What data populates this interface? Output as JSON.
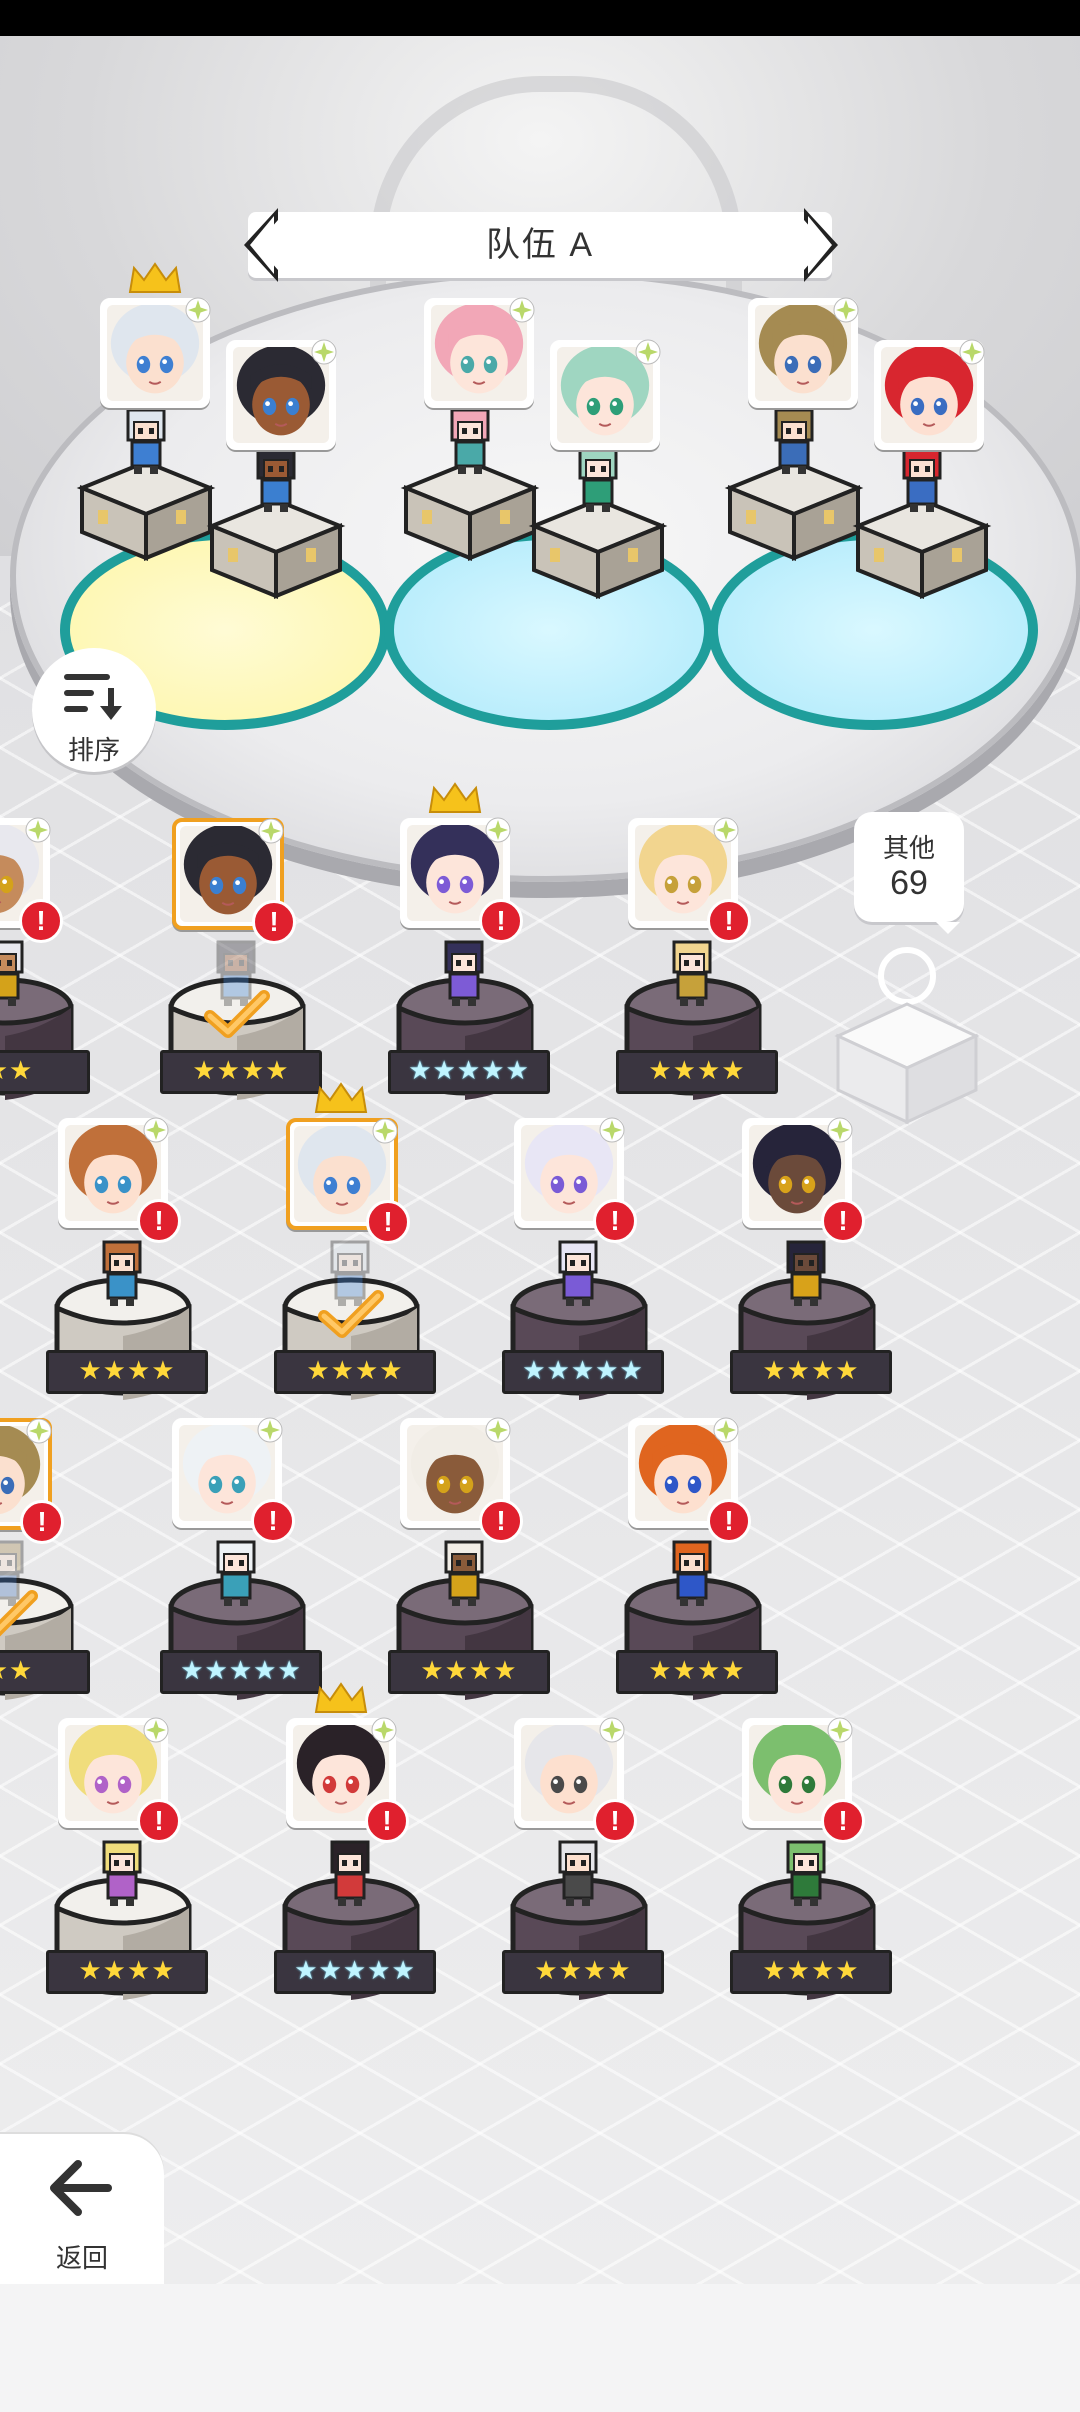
{
  "header": {
    "team_title": "队伍 A"
  },
  "sort": {
    "label": "排序"
  },
  "other": {
    "label": "其他",
    "count": "69"
  },
  "nav": {
    "back_label": "返回"
  },
  "colors": {
    "accent_orange": "#f0a020",
    "alert_red": "#e0202e",
    "teal_ring": "#1f9e9b",
    "star_gold": "#ffd83a"
  },
  "team_slots": [
    {
      "leader": true,
      "hair": "#dfe6ee",
      "skin": "#fbe0cf",
      "eyes": "#3e7fd2"
    },
    {
      "leader": false,
      "hair": "#2b2a33",
      "skin": "#9a5a34",
      "eyes": "#3b7fd0"
    },
    {
      "leader": false,
      "hair": "#f2a7b7",
      "skin": "#fde5da",
      "eyes": "#4aa9a8"
    },
    {
      "leader": false,
      "hair": "#9fd6c1",
      "skin": "#fde5da",
      "eyes": "#2e9e78"
    },
    {
      "leader": false,
      "hair": "#a58b52",
      "skin": "#fbe0cf",
      "eyes": "#3b6db8"
    },
    {
      "leader": false,
      "hair": "#d8262f",
      "skin": "#fde0d2",
      "eyes": "#3a6dc2"
    }
  ],
  "roster": [
    {
      "stars": "★★",
      "rarity": "gold",
      "crown": false,
      "selected": false,
      "hair": "#e8e8ee",
      "skin": "#c58b5c",
      "eyes": "#d4a21a"
    },
    {
      "stars": "★★★★",
      "rarity": "gold",
      "crown": false,
      "selected": true,
      "hair": "#2b2a33",
      "skin": "#9a5a34",
      "eyes": "#3b7fd0"
    },
    {
      "stars": "★★★★★",
      "rarity": "rainbow",
      "crown": true,
      "selected": false,
      "hair": "#34305a",
      "skin": "#fde5da",
      "eyes": "#7d5bd6"
    },
    {
      "stars": "★★★★",
      "rarity": "gold",
      "crown": false,
      "selected": false,
      "hair": "#f2d58f",
      "skin": "#fde5da",
      "eyes": "#c6a13a"
    },
    {
      "stars": "★★★★",
      "rarity": "gold",
      "crown": false,
      "selected": false,
      "hair": "#c0703a",
      "skin": "#fde0cf",
      "eyes": "#3a92c8"
    },
    {
      "stars": "★★★★",
      "rarity": "gold",
      "crown": true,
      "selected": true,
      "hair": "#dfe6ee",
      "skin": "#fbe0cf",
      "eyes": "#3e7fd2"
    },
    {
      "stars": "★★★★★",
      "rarity": "rainbow",
      "crown": false,
      "selected": false,
      "hair": "#e8e6f5",
      "skin": "#fde5da",
      "eyes": "#7a5bd6"
    },
    {
      "stars": "★★★★",
      "rarity": "gold",
      "crown": false,
      "selected": false,
      "hair": "#26243a",
      "skin": "#6b4a3a",
      "eyes": "#d8a21a"
    },
    {
      "stars": "★★",
      "rarity": "gold",
      "crown": false,
      "selected": true,
      "hair": "#a58b52",
      "skin": "#fbe0cf",
      "eyes": "#3b6db8"
    },
    {
      "stars": "★★★★★",
      "rarity": "rainbow",
      "crown": false,
      "selected": false,
      "hair": "#eef2f5",
      "skin": "#fde5da",
      "eyes": "#3aa0b8"
    },
    {
      "stars": "★★★★",
      "rarity": "gold",
      "crown": false,
      "selected": false,
      "hair": "#f1ede6",
      "skin": "#8a5b3a",
      "eyes": "#d4a21a"
    },
    {
      "stars": "★★★★",
      "rarity": "gold",
      "crown": false,
      "selected": false,
      "hair": "#e0651f",
      "skin": "#fde0cf",
      "eyes": "#2e57c8"
    },
    {
      "stars": "★★★★",
      "rarity": "gold",
      "crown": false,
      "selected": false,
      "hair": "#f0dd7c",
      "skin": "#fde5da",
      "eyes": "#b062c8"
    },
    {
      "stars": "★★★★★",
      "rarity": "rainbow",
      "crown": true,
      "selected": false,
      "hair": "#2a2228",
      "skin": "#fde5da",
      "eyes": "#d23a3a"
    },
    {
      "stars": "★★★★",
      "rarity": "gold",
      "crown": false,
      "selected": false,
      "hair": "#e6e6ea",
      "skin": "#fde0cf",
      "eyes": "#4a4a4a"
    },
    {
      "stars": "★★★★",
      "rarity": "gold",
      "crown": false,
      "selected": false,
      "hair": "#7cbf6e",
      "skin": "#fde5da",
      "eyes": "#2e7a3a"
    }
  ]
}
